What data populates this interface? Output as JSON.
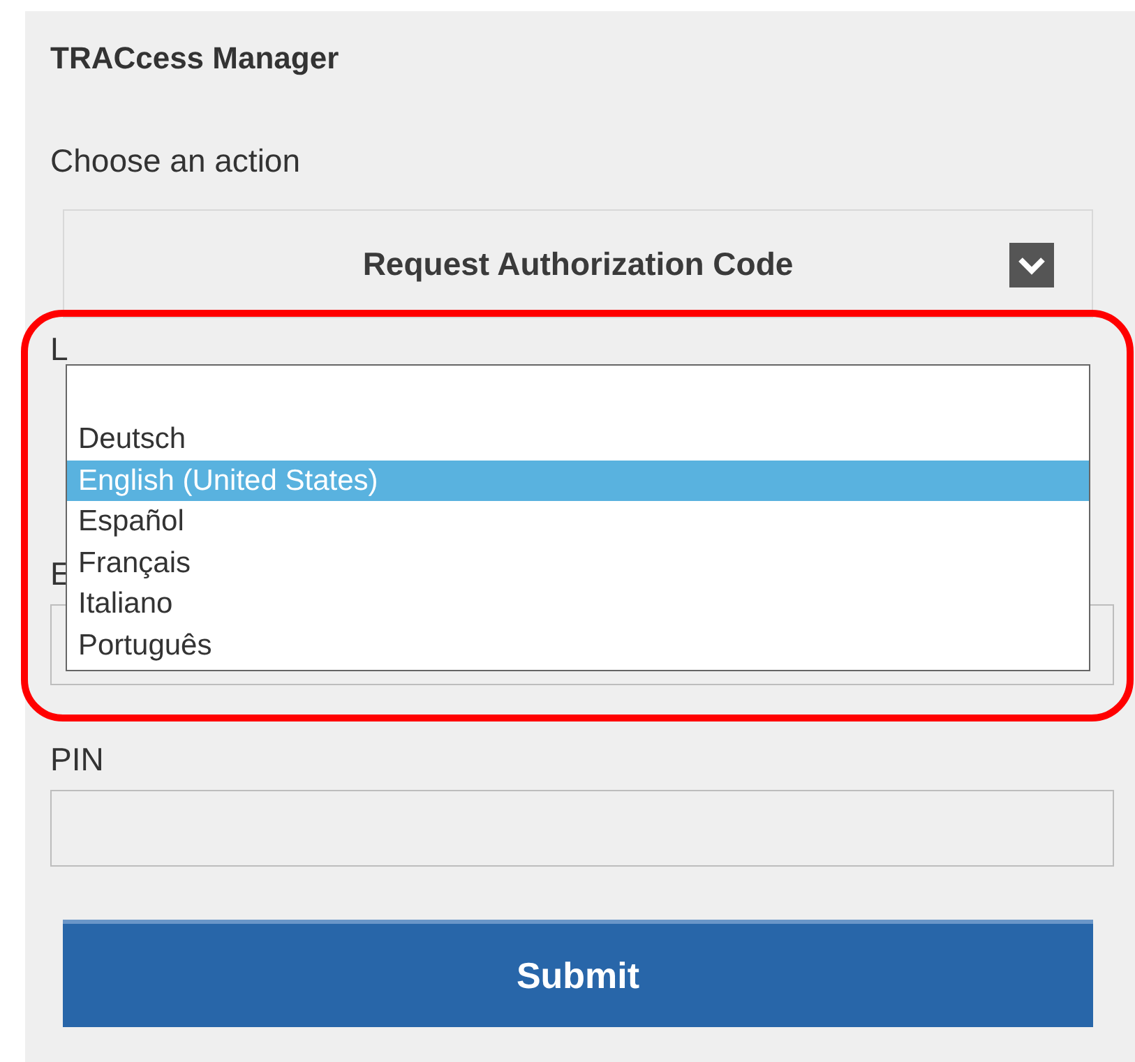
{
  "title": "TRACcess Manager",
  "action": {
    "label": "Choose an action",
    "value": "Request Authorization Code"
  },
  "language": {
    "label": "L",
    "options": [
      {
        "label": "Deutsch",
        "selected": false
      },
      {
        "label": "English (United States)",
        "selected": true
      },
      {
        "label": "Español",
        "selected": false
      },
      {
        "label": "Français",
        "selected": false
      },
      {
        "label": "Italiano",
        "selected": false
      },
      {
        "label": "Português",
        "selected": false
      }
    ]
  },
  "field_3": {
    "label": "E"
  },
  "pin": {
    "label": "PIN"
  },
  "submit": "Submit"
}
